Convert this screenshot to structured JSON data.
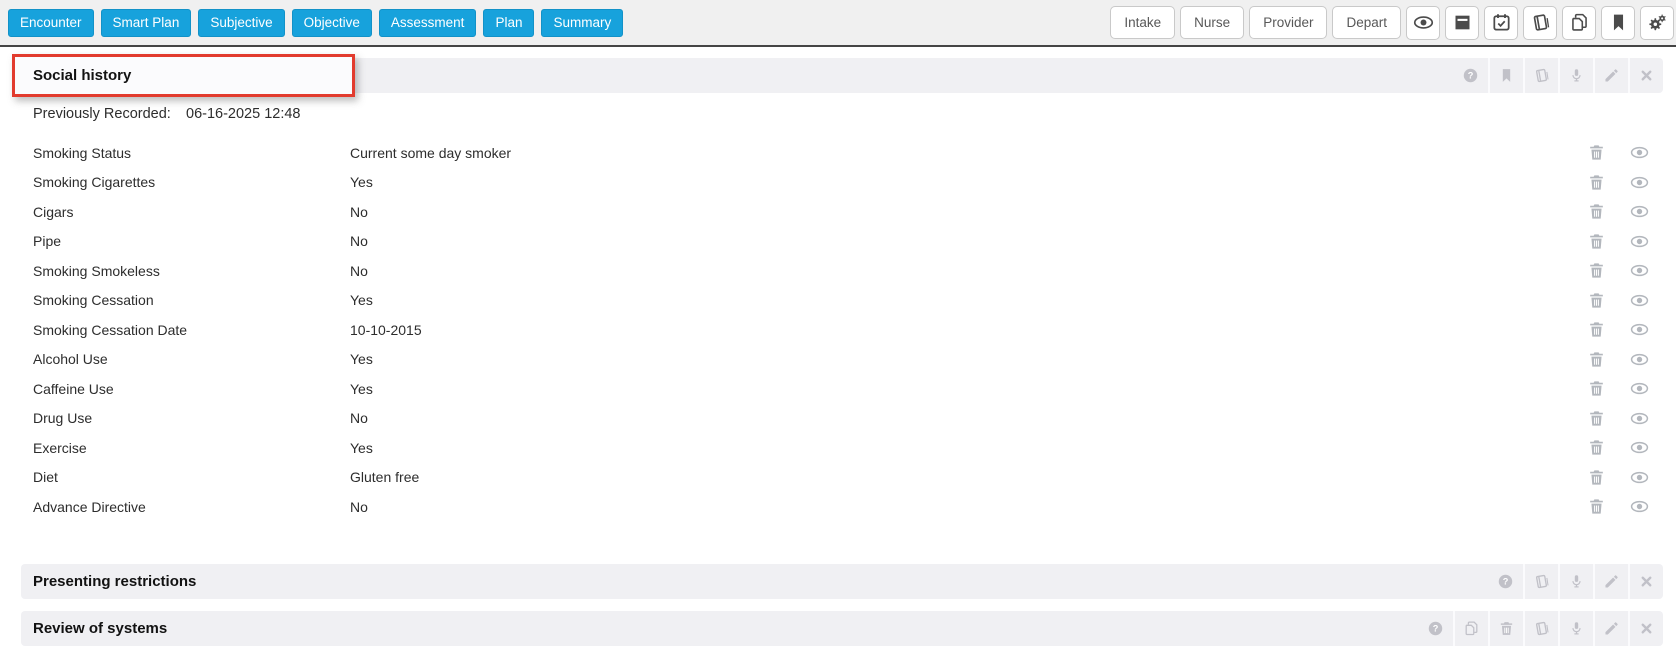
{
  "toolbar": {
    "nav_buttons": [
      "Encounter",
      "Smart Plan",
      "Subjective",
      "Objective",
      "Assessment",
      "Plan",
      "Summary"
    ],
    "stage_buttons": [
      "Intake",
      "Nurse",
      "Provider",
      "Depart"
    ],
    "icon_buttons": [
      "eye-icon",
      "archive-icon",
      "calendar-check-icon",
      "book-icon",
      "copy-icon",
      "bookmark-icon",
      "gears-icon"
    ]
  },
  "social_history": {
    "title": "Social history",
    "header_icons": [
      "help-icon",
      "bookmark-icon",
      "book-icon",
      "microphone-icon",
      "pencil-icon",
      "close-icon"
    ],
    "previously_recorded_label": "Previously Recorded:",
    "previously_recorded_value": "06-16-2025 12:48",
    "row_action_icons": [
      "trash-icon",
      "eye-icon"
    ],
    "rows": [
      {
        "label": "Smoking Status",
        "value": "Current some day smoker"
      },
      {
        "label": "Smoking Cigarettes",
        "value": "Yes"
      },
      {
        "label": "Cigars",
        "value": "No"
      },
      {
        "label": "Pipe",
        "value": "No"
      },
      {
        "label": "Smoking Smokeless",
        "value": "No"
      },
      {
        "label": "Smoking Cessation",
        "value": "Yes"
      },
      {
        "label": "Smoking Cessation Date",
        "value": "10-10-2015"
      },
      {
        "label": "Alcohol Use",
        "value": "Yes"
      },
      {
        "label": "Caffeine Use",
        "value": "Yes"
      },
      {
        "label": "Drug Use",
        "value": "No"
      },
      {
        "label": "Exercise",
        "value": "Yes"
      },
      {
        "label": "Diet",
        "value": "Gluten free"
      },
      {
        "label": "Advance Directive",
        "value": "No"
      }
    ]
  },
  "sections": [
    {
      "title": "Presenting restrictions",
      "icons": [
        "help-icon",
        "book-icon",
        "microphone-icon",
        "pencil-icon",
        "close-icon"
      ]
    },
    {
      "title": "Review of systems",
      "icons": [
        "help-icon",
        "copy-icon",
        "trash-icon",
        "book-icon",
        "microphone-icon",
        "pencil-icon",
        "close-icon"
      ]
    }
  ],
  "colors": {
    "accent_blue": "#17a2dc",
    "annotation_red": "#e23b2e",
    "toolbar_bg": "#f0f0f0",
    "section_bar_bg": "#f0f0f3"
  }
}
